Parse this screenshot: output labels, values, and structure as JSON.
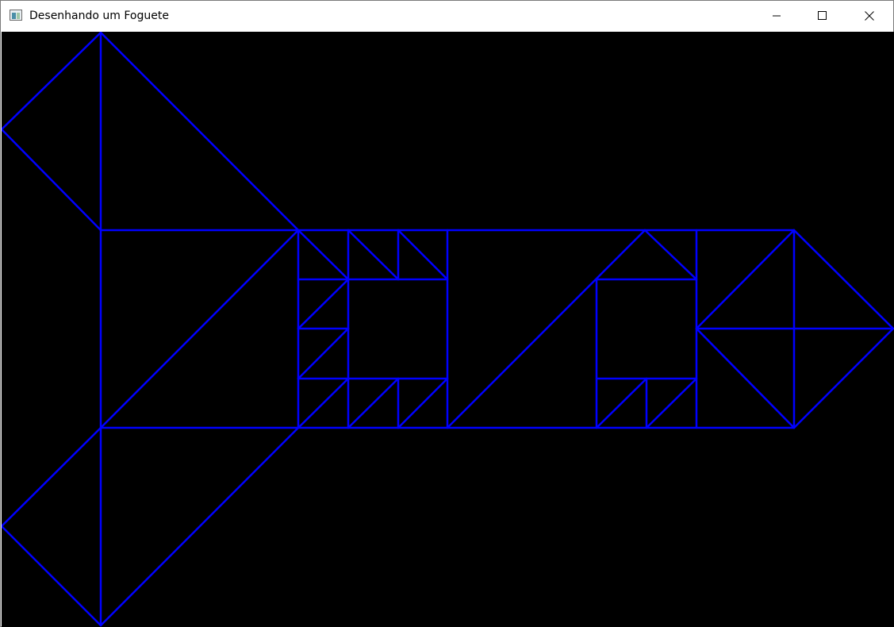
{
  "window": {
    "title": "Desenhando um Foguete",
    "icons": {
      "app": "app-window-icon",
      "minimize": "minimize-icon",
      "maximize": "maximize-icon",
      "close": "close-icon"
    }
  },
  "canvas": {
    "background": "#000000",
    "stroke_color": "#0000ff",
    "drawing": "rocket-wireframe"
  }
}
